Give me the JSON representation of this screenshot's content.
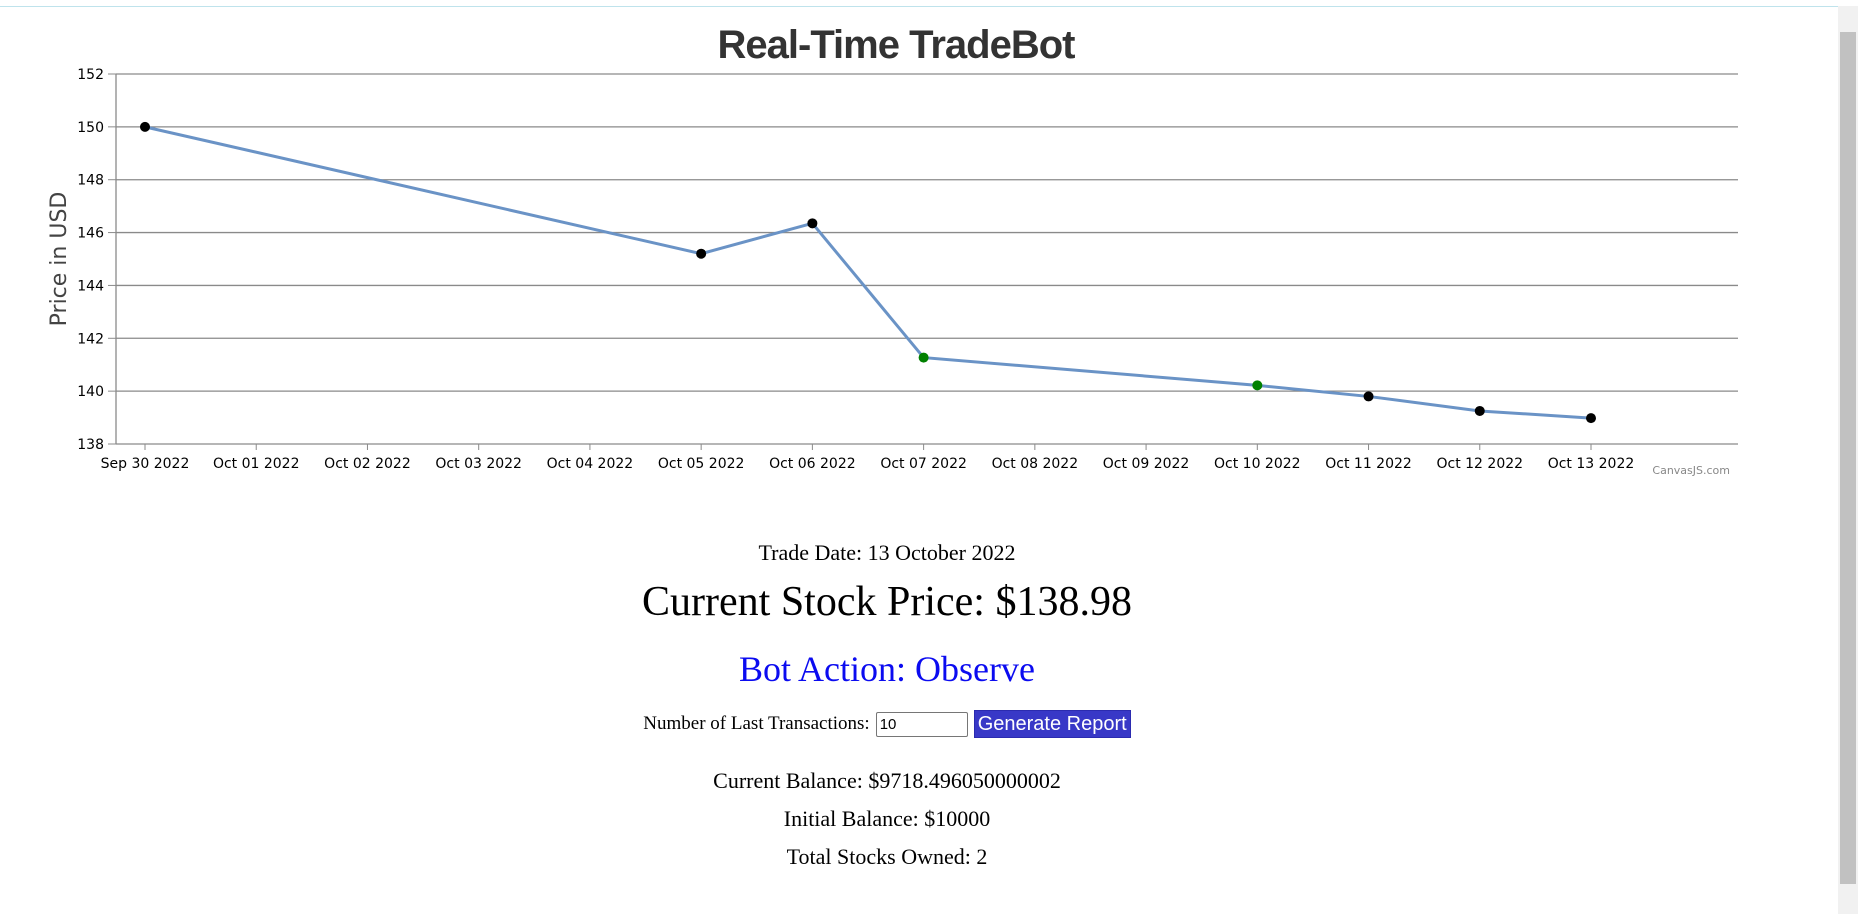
{
  "chart_data": {
    "type": "line",
    "title": "Real-Time TradeBot",
    "ylabel": "Price in USD",
    "xlabel": "",
    "ylim": [
      138,
      152
    ],
    "yticks": [
      138,
      140,
      142,
      144,
      146,
      148,
      150,
      152
    ],
    "xticks": [
      "Sep 30 2022",
      "Oct 01 2022",
      "Oct 02 2022",
      "Oct 03 2022",
      "Oct 04 2022",
      "Oct 05 2022",
      "Oct 06 2022",
      "Oct 07 2022",
      "Oct 08 2022",
      "Oct 09 2022",
      "Oct 10 2022",
      "Oct 11 2022",
      "Oct 12 2022",
      "Oct 13 2022"
    ],
    "grid": true,
    "series": [
      {
        "color": "#6a93c6",
        "points": [
          {
            "x": "2022-09-30",
            "y": 150.0,
            "marker": "#000000"
          },
          {
            "x": "2022-10-05",
            "y": 145.2,
            "marker": "#000000"
          },
          {
            "x": "2022-10-06",
            "y": 146.35,
            "marker": "#000000"
          },
          {
            "x": "2022-10-07",
            "y": 141.27,
            "marker": "#008000"
          },
          {
            "x": "2022-10-10",
            "y": 140.22,
            "marker": "#008000"
          },
          {
            "x": "2022-10-11",
            "y": 139.8,
            "marker": "#000000"
          },
          {
            "x": "2022-10-12",
            "y": 139.25,
            "marker": "#000000"
          },
          {
            "x": "2022-10-13",
            "y": 138.98,
            "marker": "#000000"
          }
        ]
      }
    ],
    "credit": "CanvasJS.com"
  },
  "info": {
    "trade_date": "Trade Date: 13 October 2022",
    "current_price": "Current Stock Price: $138.98",
    "bot_action": "Bot Action: Observe",
    "transactions_label": "Number of Last Transactions:",
    "transactions_value": "10",
    "generate_button": "Generate Report",
    "current_balance": "Current Balance: $9718.496050000002",
    "initial_balance": "Initial Balance: $10000",
    "stocks_owned": "Total Stocks Owned: 2"
  },
  "colors": {
    "line": "#6a93c6",
    "bot_action": "#0b0bf0",
    "button_bg": "#3838c7"
  }
}
